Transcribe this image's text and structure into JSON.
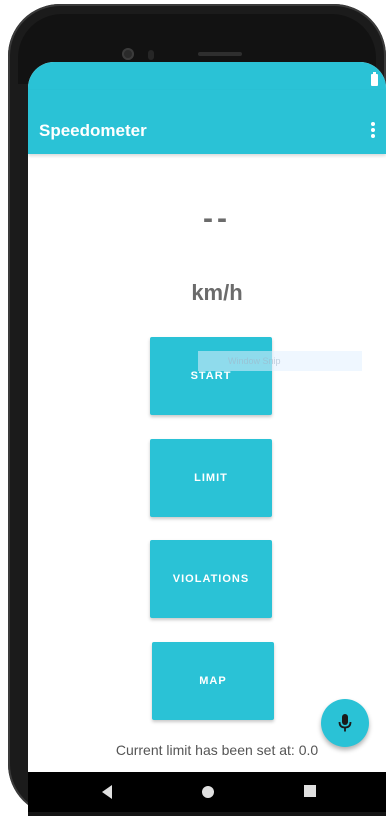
{
  "app_bar": {
    "title": "Speedometer",
    "menu_icon": "more-vert-icon"
  },
  "speed": {
    "value": "--",
    "unit": "km/h"
  },
  "buttons": {
    "start": "START",
    "limit": "LIMIT",
    "violations": "VIOLATIONS",
    "map": "MAP"
  },
  "overlay": {
    "label": "Window Snip"
  },
  "fab": {
    "icon": "microphone-icon"
  },
  "footer": {
    "limit_text": "Current limit has been set at: 0.0"
  },
  "nav": {
    "back_icon": "back-triangle-icon",
    "home_icon": "home-circle-icon",
    "recents_icon": "recents-square-icon"
  },
  "colors": {
    "accent": "#2ac2d6",
    "text_gray": "#6b6b6b",
    "status_bar_battery": "#ffffff"
  }
}
